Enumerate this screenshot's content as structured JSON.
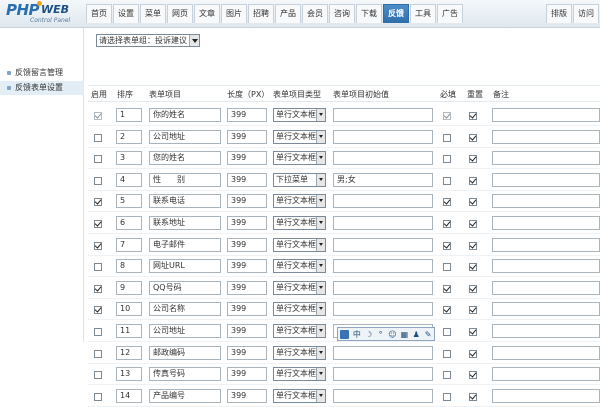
{
  "logo": {
    "php": "PHP",
    "web": "WEB",
    "subtitle": "Control Panel"
  },
  "nav": [
    "首页",
    "设置",
    "菜单",
    "网页",
    "文章",
    "图片",
    "招聘",
    "产品",
    "会员",
    "咨询",
    "下载",
    "反馈",
    "工具",
    "广告"
  ],
  "nav_active": "反馈",
  "right_buttons": [
    "排版",
    "访问"
  ],
  "sidebar": {
    "items": [
      "反馈留言管理",
      "反馈表单设置"
    ],
    "active": "反馈表单设置"
  },
  "filter": {
    "label": "请选择表单组：投诉建议"
  },
  "columns": {
    "enabled": "启用",
    "order": "排序",
    "item": "表单项目",
    "length": "长度（PX）",
    "type": "表单项目类型",
    "initial": "表单项目初始值",
    "required": "必填",
    "reset": "重置",
    "note": "备注"
  },
  "rows": [
    {
      "enabled": true,
      "enabled_locked": true,
      "order": "1",
      "name": "你的姓名",
      "length": "399",
      "type": "单行文本框",
      "initial": "",
      "required": true,
      "required_locked": true,
      "reset": true
    },
    {
      "enabled": false,
      "enabled_locked": false,
      "order": "2",
      "name": "公司地址",
      "length": "399",
      "type": "单行文本框",
      "initial": "",
      "required": false,
      "required_locked": false,
      "reset": true
    },
    {
      "enabled": false,
      "enabled_locked": false,
      "order": "3",
      "name": "您的姓名",
      "length": "399",
      "type": "单行文本框",
      "initial": "",
      "required": false,
      "required_locked": false,
      "reset": true
    },
    {
      "enabled": false,
      "enabled_locked": false,
      "order": "4",
      "name": "性　　别",
      "length": "399",
      "type": "下拉菜单",
      "initial": "男;女",
      "required": false,
      "required_locked": false,
      "reset": true
    },
    {
      "enabled": true,
      "enabled_locked": false,
      "order": "5",
      "name": "联系电话",
      "length": "399",
      "type": "单行文本框",
      "initial": "",
      "required": true,
      "required_locked": false,
      "reset": true
    },
    {
      "enabled": true,
      "enabled_locked": false,
      "order": "6",
      "name": "联系地址",
      "length": "399",
      "type": "单行文本框",
      "initial": "",
      "required": true,
      "required_locked": false,
      "reset": true
    },
    {
      "enabled": true,
      "enabled_locked": false,
      "order": "7",
      "name": "电子邮件",
      "length": "399",
      "type": "单行文本框",
      "initial": "",
      "required": true,
      "required_locked": false,
      "reset": true
    },
    {
      "enabled": false,
      "enabled_locked": false,
      "order": "8",
      "name": "网址URL",
      "length": "399",
      "type": "单行文本框",
      "initial": "",
      "required": false,
      "required_locked": false,
      "reset": true
    },
    {
      "enabled": true,
      "enabled_locked": false,
      "order": "9",
      "name": "QQ号码",
      "length": "399",
      "type": "单行文本框",
      "initial": "",
      "required": true,
      "required_locked": false,
      "reset": true
    },
    {
      "enabled": true,
      "enabled_locked": false,
      "order": "10",
      "name": "公司名称",
      "length": "399",
      "type": "单行文本框",
      "initial": "",
      "required": true,
      "required_locked": false,
      "reset": true
    },
    {
      "enabled": false,
      "enabled_locked": false,
      "order": "11",
      "name": "公司地址",
      "length": "399",
      "type": "单行文本框",
      "initial": "",
      "required": false,
      "required_locked": false,
      "reset": true
    },
    {
      "enabled": false,
      "enabled_locked": false,
      "order": "12",
      "name": "邮政编码",
      "length": "399",
      "type": "单行文本框",
      "initial": "",
      "required": false,
      "required_locked": false,
      "reset": true
    },
    {
      "enabled": false,
      "enabled_locked": false,
      "order": "13",
      "name": "传真号码",
      "length": "399",
      "type": "单行文本框",
      "initial": "",
      "required": false,
      "required_locked": false,
      "reset": true
    },
    {
      "enabled": false,
      "enabled_locked": false,
      "order": "14",
      "name": "产品编号",
      "length": "399",
      "type": "单行文本框",
      "initial": "",
      "required": false,
      "required_locked": false,
      "reset": true
    }
  ],
  "ime": {
    "lang": "中"
  },
  "colors": {
    "accent": "#2e6ea8",
    "nav_bg": "#dfe8ef",
    "sidebar_active": "#e3edf6"
  }
}
